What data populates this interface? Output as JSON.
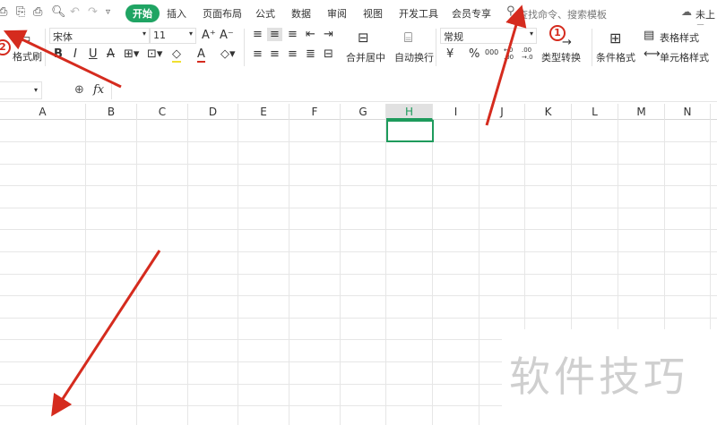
{
  "quick_access": {
    "save": "save-icon",
    "export": "export-icon",
    "print": "print-icon",
    "preview": "print-preview-icon",
    "undo": "undo-icon",
    "redo": "redo-icon",
    "more": "more-icon"
  },
  "tabs": [
    "开始",
    "插入",
    "页面布局",
    "公式",
    "数据",
    "审阅",
    "视图",
    "开发工具",
    "会员专享"
  ],
  "search": {
    "placeholder": "查找命令、搜索模板"
  },
  "sync": "未上云",
  "ribbon": {
    "format_painter": "格式刷",
    "font_name": "宋体",
    "font_size": "11",
    "merge_center": "合并居中",
    "wrap_text": "自动换行",
    "number_format": "常规",
    "currency": "¥",
    "percent": "%",
    "thousands": "000",
    "inc_dec": "←0 .00",
    "dec_dec": ".00 →.0",
    "type_convert": "类型转换",
    "conditional_format": "条件格式",
    "table_style": "表格样式",
    "cell_style": "单元格样式"
  },
  "formula_bar": {
    "fx": "fx",
    "value": ""
  },
  "columns": [
    "A",
    "B",
    "C",
    "D",
    "E",
    "F",
    "G",
    "H",
    "I",
    "J",
    "K",
    "L",
    "M",
    "N"
  ],
  "selected_column": "H",
  "annotations": {
    "one": "1",
    "two": "2"
  },
  "watermark": "软件技巧",
  "colors": {
    "accent": "#1fa463",
    "arrow": "#d52b1e"
  }
}
